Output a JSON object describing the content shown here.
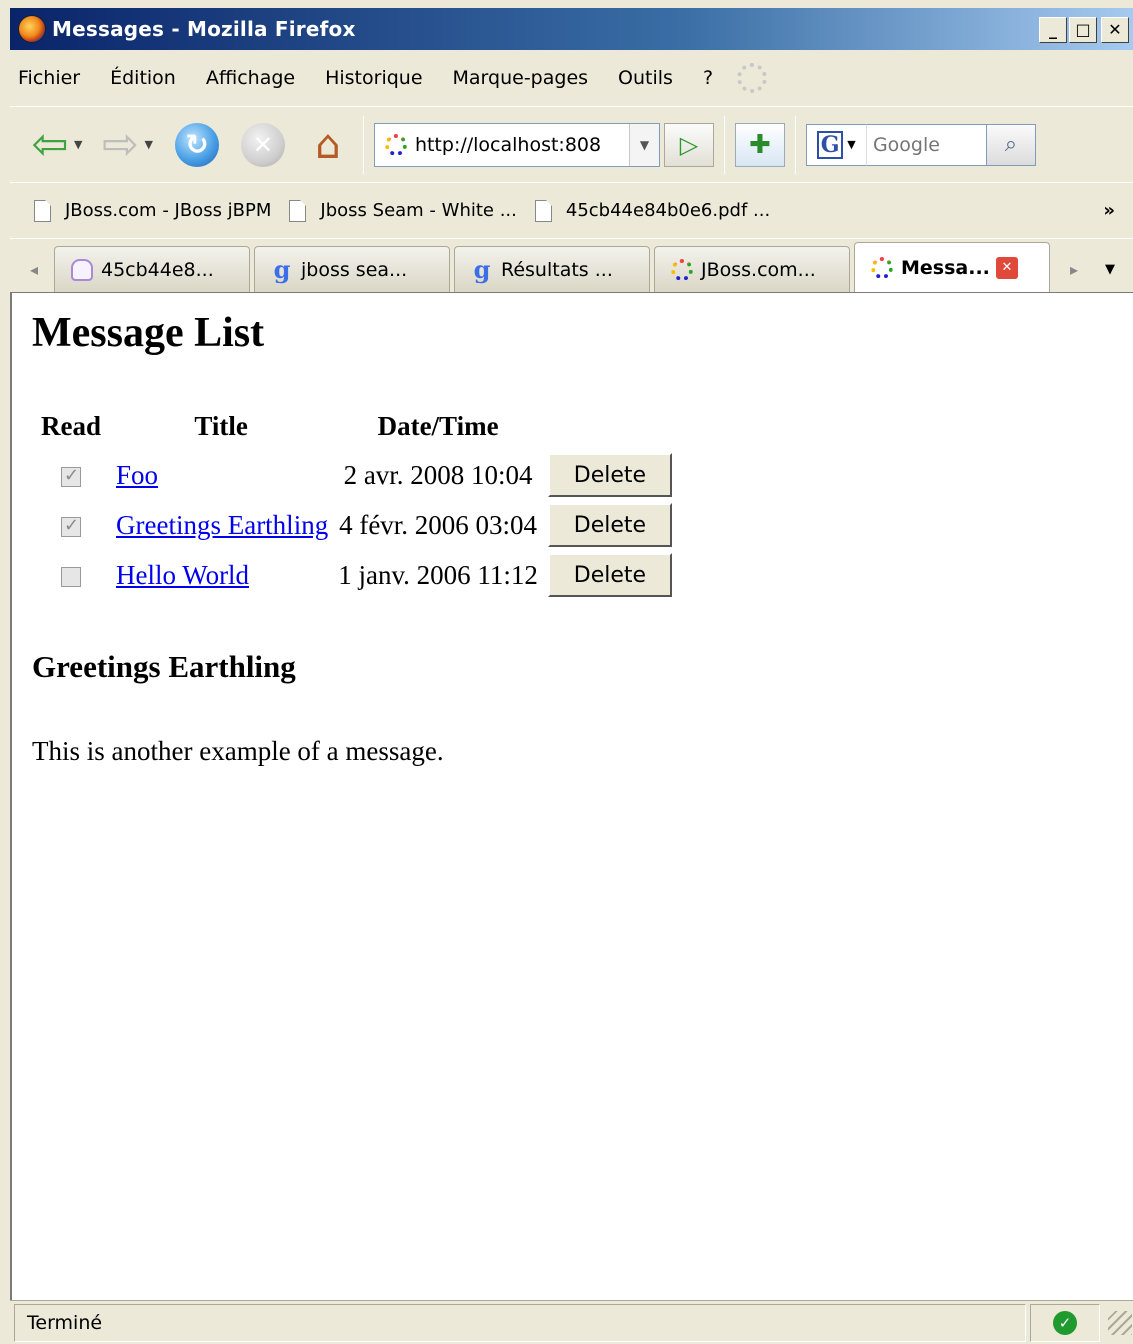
{
  "window": {
    "title": "Messages - Mozilla Firefox",
    "controls": {
      "minimize": "_",
      "maximize": "□",
      "close": "✕"
    }
  },
  "menu": {
    "items": [
      "Fichier",
      "Édition",
      "Affichage",
      "Historique",
      "Marque-pages",
      "Outils",
      "?"
    ]
  },
  "navigation": {
    "url": "http://localhost:808",
    "search_placeholder": "Google"
  },
  "bookmarks": {
    "items": [
      "JBoss.com - JBoss jBPM",
      "Jboss Seam - White ...",
      "45cb44e84b0e6.pdf ..."
    ],
    "more": "»"
  },
  "tabs": {
    "items": [
      {
        "label": "45cb44e8...",
        "icon": "penguin-icon"
      },
      {
        "label": "jboss sea...",
        "icon": "google-icon"
      },
      {
        "label": "Résultats ...",
        "icon": "google-icon"
      },
      {
        "label": "JBoss.com...",
        "icon": "site-icon"
      },
      {
        "label": "Messa...",
        "icon": "site-icon",
        "active": true
      }
    ]
  },
  "page": {
    "heading": "Message List",
    "table": {
      "headers": [
        "Read",
        "Title",
        "Date/Time"
      ],
      "rows": [
        {
          "read": true,
          "title": "Foo",
          "datetime": "2 avr. 2008 10:04",
          "action": "Delete"
        },
        {
          "read": true,
          "title": "Greetings Earthling",
          "datetime": "4 févr. 2006 03:04",
          "action": "Delete"
        },
        {
          "read": false,
          "title": "Hello World",
          "datetime": "1 janv. 2006 11:12",
          "action": "Delete"
        }
      ]
    },
    "detail": {
      "title": "Greetings Earthling",
      "body": "This is another example of a message."
    }
  },
  "status": {
    "text": "Terminé"
  }
}
